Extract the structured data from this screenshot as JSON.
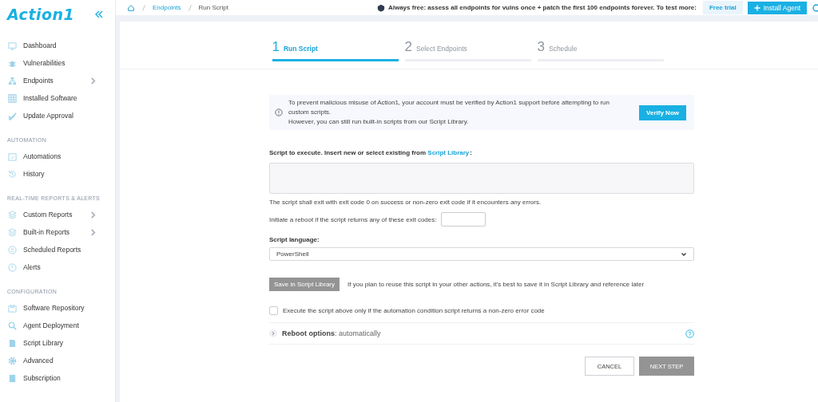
{
  "logo": {
    "text": "Action1"
  },
  "sidebar": {
    "sections": [
      {
        "items": [
          {
            "label": "Dashboard",
            "has_submenu": false
          },
          {
            "label": "Vulnerabilities",
            "has_submenu": false
          },
          {
            "label": "Endpoints",
            "has_submenu": true
          },
          {
            "label": "Installed Software",
            "has_submenu": false
          },
          {
            "label": "Update Approval",
            "has_submenu": false
          }
        ]
      },
      {
        "heading": "AUTOMATION",
        "items": [
          {
            "label": "Automations",
            "has_submenu": false
          },
          {
            "label": "History",
            "has_submenu": false
          }
        ]
      },
      {
        "heading": "REAL-TIME REPORTS & ALERTS",
        "items": [
          {
            "label": "Custom Reports",
            "has_submenu": true
          },
          {
            "label": "Built-in Reports",
            "has_submenu": true
          },
          {
            "label": "Scheduled Reports",
            "has_submenu": false
          },
          {
            "label": "Alerts",
            "has_submenu": false
          }
        ]
      },
      {
        "heading": "CONFIGURATION",
        "items": [
          {
            "label": "Software Repository",
            "has_submenu": false
          },
          {
            "label": "Agent Deployment",
            "has_submenu": false
          },
          {
            "label": "Script Library",
            "has_submenu": false
          },
          {
            "label": "Advanced",
            "has_submenu": false
          },
          {
            "label": "Subscription",
            "has_submenu": false
          }
        ]
      }
    ]
  },
  "breadcrumb": [
    "Endpoints",
    "Run Script"
  ],
  "promo": {
    "text": "Always free: assess all endpoints for vulns once + patch the first 100 endpoints forever. To test more:",
    "trial_button": "Free trial",
    "install_button": "Install Agent"
  },
  "steps": [
    {
      "number": "1",
      "label": "Run Script",
      "selected": true
    },
    {
      "number": "2",
      "label": "Select Endpoints",
      "selected": false
    },
    {
      "number": "3",
      "label": "Schedule",
      "selected": false
    }
  ],
  "alert": {
    "lines": [
      "To prevent malicious misuse of Action1, your account must be verified by Action1 support before attempting to run custom scripts.",
      "However, you can still run built-in scripts from our Script Library."
    ],
    "button": "Verify Now"
  },
  "script": {
    "label": "Script to execute. Insert new or select existing from",
    "link": "Script Library",
    "label_end": ":",
    "hint": "The script shall exit with exit code 0 on success or non-zero exit code if it encounters any errors."
  },
  "reboot_codes": {
    "label": "Initiate a reboot if the script returns any of these exit codes:"
  },
  "language": {
    "label": "Script language:",
    "value": "PowerShell"
  },
  "save": {
    "button": "Save in Script Library",
    "disabled": true,
    "note": "If you plan to reuse this script in your other actions, it's best to save it in Script Library and reference later"
  },
  "condition": {
    "label": "Execute the script above only if the automation condition script returns a non-zero error code",
    "checked": false
  },
  "reboot_options": {
    "text": "**Reboot options**: automatically",
    "expanded": false
  },
  "actions": {
    "cancel": "CANCEL",
    "next": "NEXT STEP",
    "next_disabled": true
  }
}
